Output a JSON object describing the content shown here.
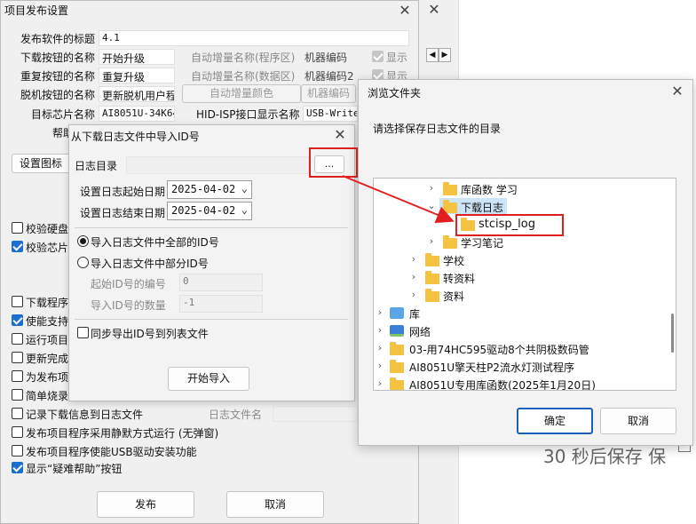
{
  "main": {
    "title": "项目发布设置",
    "labels": {
      "title_label": "发布软件的标题",
      "download_btn_label": "下载按钮的名称",
      "repeat_btn_label": "重复按钮的名称",
      "offline_btn_label": "脱机按钮的名称",
      "target_chip_label": "目标芯片名称",
      "help_label": "帮助",
      "auto_inc_prog": "自动增量名称(程序区)",
      "auto_inc_data": "自动增量名称(数据区)",
      "machine_code": "机器编码",
      "machine_code2": "机器编码2",
      "hid_isp_label": "HID-ISP接口显示名称",
      "log_filename_label": "日志文件名"
    },
    "values": {
      "title_value": "4.1",
      "download_value": "开始升级",
      "repeat_value": "重复升级",
      "offline_value": "更新脱机用户程",
      "chip_value": "AI8051U-34K64",
      "hid_value": "USB-Writer"
    },
    "buttons": {
      "auto_inc_color": "自动增量颜色",
      "machine_code_btn": "机器编码",
      "set_icon": "设置图标",
      "publish": "发布",
      "cancel": "取消"
    },
    "show_label": "显示",
    "checkboxes": [
      {
        "label": "校验硬盘",
        "checked": false
      },
      {
        "label": "校验芯片",
        "checked": true
      },
      {
        "label": "下载程序",
        "checked": false
      },
      {
        "label": "使能支持",
        "checked": true
      },
      {
        "label": "运行项目",
        "checked": false
      },
      {
        "label": "更新完成",
        "checked": false
      },
      {
        "label": "为发布项",
        "checked": false
      },
      {
        "label": "简单烧录",
        "checked": false
      },
      {
        "label": "记录下载信息到日志文件",
        "checked": false
      },
      {
        "label": "发布项目程序采用静默方式运行 (无弹窗)",
        "checked": false
      },
      {
        "label": "发布项目程序使能USB驱动安装功能",
        "checked": false
      },
      {
        "label": "显示“疑难帮助”按钮",
        "checked": true
      }
    ],
    "right_partial": {
      "banner": "30 秒后保存 保"
    }
  },
  "import_dialog": {
    "title": "从下载日志文件中导入ID号",
    "log_dir_label": "日志目录",
    "browse": "...",
    "start_date_label": "设置日志起始日期",
    "start_date": "2025-04-02",
    "end_date_label": "设置日志结束日期",
    "end_date": "2025-04-02",
    "radio_all": "导入日志文件中全部的ID号",
    "radio_partial": "导入日志文件中部分ID号",
    "start_id_label": "起始ID号的编号",
    "start_id_value": "0",
    "id_count_label": "导入ID号的数量",
    "id_count_value": "-1",
    "sync_label": "同步导出ID号到列表文件",
    "start_import": "开始导入"
  },
  "browse_dialog": {
    "title": "浏览文件夹",
    "prompt": "请选择保存日志文件的目录",
    "tree": [
      {
        "label": "库函数 学习",
        "state": "collapsed"
      },
      {
        "label": "下载日志",
        "state": "expanded",
        "selected": true
      },
      {
        "label": "stcisp_log",
        "state": "leaf"
      },
      {
        "label": "学习笔记",
        "state": "collapsed"
      },
      {
        "label": "学校",
        "state": "collapsed"
      },
      {
        "label": "转资料",
        "state": "collapsed"
      },
      {
        "label": "资料",
        "state": "collapsed"
      },
      {
        "label": "库",
        "state": "collapsed"
      },
      {
        "label": "网络",
        "state": "collapsed"
      },
      {
        "label": "03-用74HC595驱动8个共阴极数码管",
        "state": "collapsed"
      },
      {
        "label": "AI8051U擎天柱P2流水灯测试程序",
        "state": "collapsed"
      },
      {
        "label": "AI8051U专用库函数(2025年1月20日)",
        "state": "collapsed"
      }
    ],
    "ok": "确定",
    "cancel": "取消"
  },
  "colors": {
    "accent": "#1a6fd0",
    "highlight": "#e02020",
    "folder": "#f5c242",
    "selection": "#cce4f7"
  }
}
